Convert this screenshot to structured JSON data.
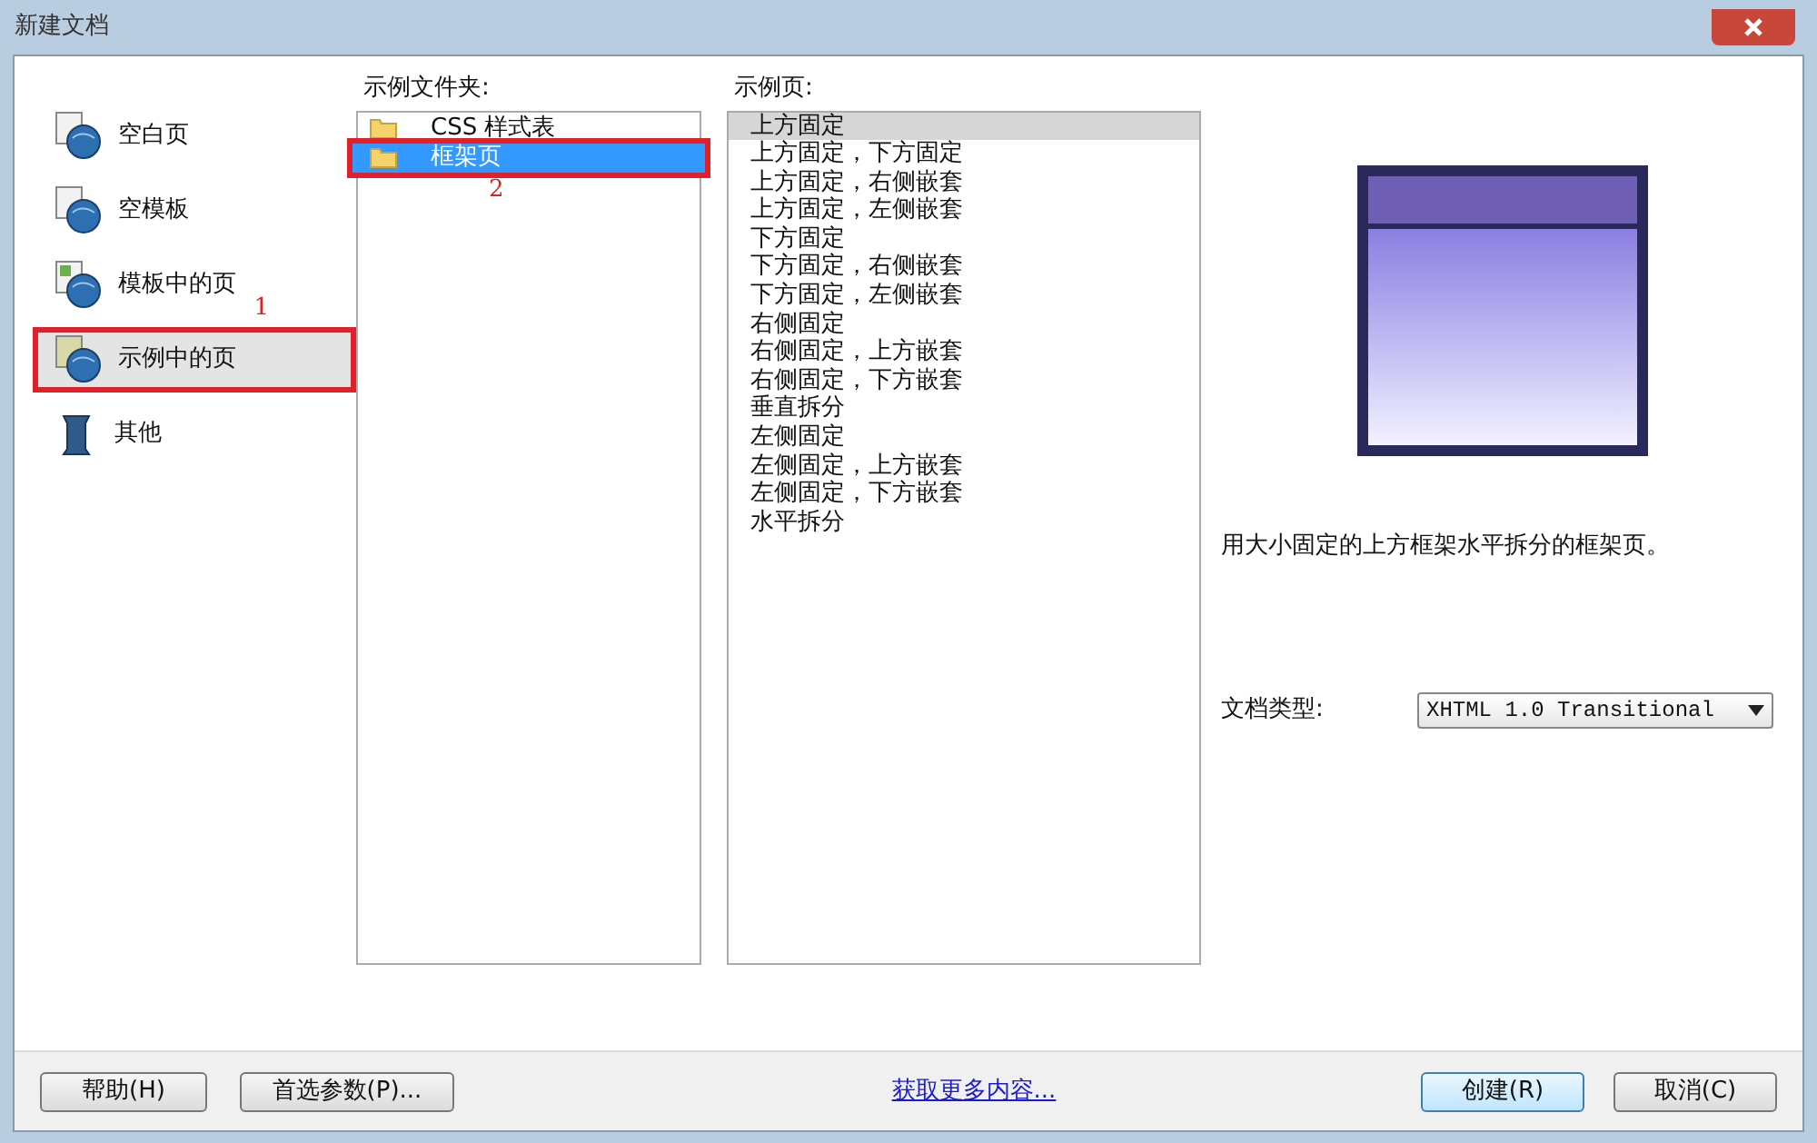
{
  "window": {
    "title": "新建文档"
  },
  "categories": [
    {
      "label": "空白页",
      "selected": false
    },
    {
      "label": "空模板",
      "selected": false
    },
    {
      "label": "模板中的页",
      "selected": false
    },
    {
      "label": "示例中的页",
      "selected": true
    },
    {
      "label": "其他",
      "selected": false
    }
  ],
  "folders": {
    "label": "示例文件夹:",
    "items": [
      {
        "label": "CSS 样式表",
        "selected": false
      },
      {
        "label": "框架页",
        "selected": true
      }
    ]
  },
  "pages": {
    "label": "示例页:",
    "items": [
      {
        "label": "上方固定",
        "selected": true
      },
      {
        "label": "上方固定，下方固定",
        "selected": false
      },
      {
        "label": "上方固定，右侧嵌套",
        "selected": false
      },
      {
        "label": "上方固定，左侧嵌套",
        "selected": false
      },
      {
        "label": "下方固定",
        "selected": false
      },
      {
        "label": "下方固定，右侧嵌套",
        "selected": false
      },
      {
        "label": "下方固定，左侧嵌套",
        "selected": false
      },
      {
        "label": "右侧固定",
        "selected": false
      },
      {
        "label": "右侧固定，上方嵌套",
        "selected": false
      },
      {
        "label": "右侧固定，下方嵌套",
        "selected": false
      },
      {
        "label": "垂直拆分",
        "selected": false
      },
      {
        "label": "左侧固定",
        "selected": false
      },
      {
        "label": "左侧固定，上方嵌套",
        "selected": false
      },
      {
        "label": "左侧固定，下方嵌套",
        "selected": false
      },
      {
        "label": "水平拆分",
        "selected": false
      }
    ]
  },
  "description": "用大小固定的上方框架水平拆分的框架页。",
  "doctype": {
    "label": "文档类型:",
    "value": "XHTML 1.0 Transitional"
  },
  "annotations": [
    "1",
    "2"
  ],
  "buttons": {
    "help": "帮助(H)",
    "preferences": "首选参数(P)...",
    "more_link": "获取更多内容...",
    "create": "创建(R)",
    "cancel": "取消(C)"
  }
}
